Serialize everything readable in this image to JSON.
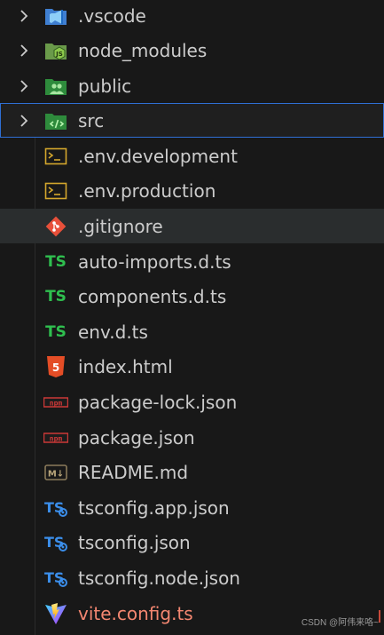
{
  "explorer": {
    "folders": [
      {
        "name": ".vscode",
        "icon": "vscode-folder-icon"
      },
      {
        "name": "node_modules",
        "icon": "node-modules-folder-icon"
      },
      {
        "name": "public",
        "icon": "public-folder-icon"
      },
      {
        "name": "src",
        "icon": "src-folder-icon"
      }
    ],
    "files": [
      {
        "name": ".env.development",
        "icon": "terminal-icon"
      },
      {
        "name": ".env.production",
        "icon": "terminal-icon"
      },
      {
        "name": ".gitignore",
        "icon": "git-icon"
      },
      {
        "name": "auto-imports.d.ts",
        "icon": "typescript-icon",
        "icon_text": "TS"
      },
      {
        "name": "components.d.ts",
        "icon": "typescript-icon",
        "icon_text": "TS"
      },
      {
        "name": "env.d.ts",
        "icon": "typescript-icon",
        "icon_text": "TS"
      },
      {
        "name": "index.html",
        "icon": "html5-icon",
        "icon_text": "5"
      },
      {
        "name": "package-lock.json",
        "icon": "npm-icon",
        "icon_text": "npm"
      },
      {
        "name": "package.json",
        "icon": "npm-icon",
        "icon_text": "npm"
      },
      {
        "name": "README.md",
        "icon": "markdown-icon",
        "icon_text": "M↓"
      },
      {
        "name": "tsconfig.app.json",
        "icon": "tsconfig-icon",
        "icon_text": "TS"
      },
      {
        "name": "tsconfig.json",
        "icon": "tsconfig-icon",
        "icon_text": "TS"
      },
      {
        "name": "tsconfig.node.json",
        "icon": "tsconfig-icon",
        "icon_text": "TS"
      },
      {
        "name": "vite.config.ts",
        "icon": "vite-icon"
      }
    ],
    "selected": "src",
    "hovered": ".gitignore",
    "warning_file": "vite.config.ts"
  },
  "watermark": "CSDN @阿伟来咯~",
  "colors": {
    "background": "#181818",
    "selection_border": "#2f6fd4",
    "hover_background": "#2a2d2e",
    "warning_text": "#f48771",
    "ts_green": "#2fbf4f"
  }
}
